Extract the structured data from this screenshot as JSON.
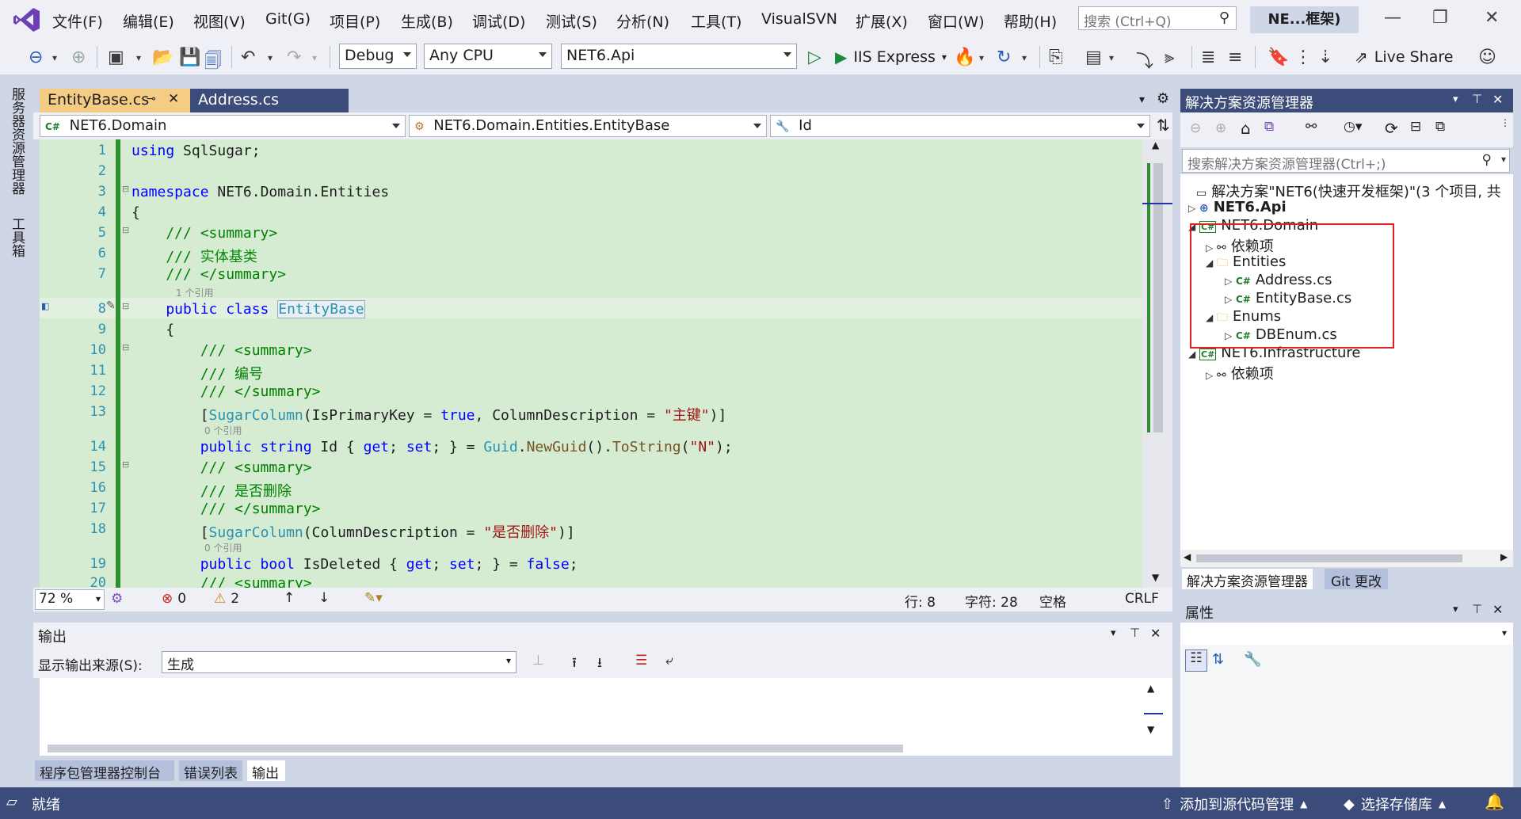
{
  "menu": {
    "items": [
      "文件(F)",
      "编辑(E)",
      "视图(V)",
      "Git(G)",
      "项目(P)",
      "生成(B)",
      "调试(D)",
      "测试(S)",
      "分析(N)",
      "工具(T)",
      "VisualSVN",
      "扩展(X)",
      "窗口(W)",
      "帮助(H)"
    ],
    "search_placeholder": "搜索 (Ctrl+Q)",
    "solution_title": "NE...框架)"
  },
  "toolbar": {
    "config": "Debug",
    "platform": "Any CPU",
    "startup_project": "NET6.Api",
    "run_label": "IIS Express",
    "live_share": "Live Share"
  },
  "siderail": {
    "server_explorer": "服务器资源管理器",
    "toolbox": "工具箱"
  },
  "tabs": {
    "active": "EntityBase.cs",
    "inactive": "Address.cs"
  },
  "navbar": {
    "project": "NET6.Domain",
    "type": "NET6.Domain.Entities.EntityBase",
    "member": "Id"
  },
  "editor": {
    "line_numbers": [
      "1",
      "2",
      "3",
      "4",
      "5",
      "6",
      "7",
      "8",
      "9",
      "10",
      "11",
      "12",
      "13",
      "14",
      "15",
      "16",
      "17",
      "18",
      "19",
      "20"
    ],
    "lens_refs_1": "1 个引用",
    "lens_refs_0a": "0 个引用",
    "lens_refs_0b": "0 个引用",
    "lines": {
      "l1_kw": "using",
      "l1_rest": " SqlSugar;",
      "l3_kw": "namespace",
      "l3_rest": " NET6.Domain.Entities",
      "l4": "{",
      "l5": "    /// <summary>",
      "l6_a": "    /// ",
      "l6_b": "实体基类",
      "l7": "    /// </summary>",
      "l8_kw": "    public class ",
      "l8_cls": "EntityBase",
      "l9": "    {",
      "l10": "        /// <summary>",
      "l11_a": "        /// ",
      "l11_b": "编号",
      "l12": "        /// </summary>",
      "l13_a": "        [",
      "l13_attr": "SugarColumn",
      "l13_b": "(IsPrimaryKey = ",
      "l13_true": "true",
      "l13_c": ", ColumnDescription = ",
      "l13_str": "\"主键\"",
      "l13_d": ")]",
      "l14_kw": "        public string",
      "l14_a": " Id { ",
      "l14_get": "get",
      "l14_b": "; ",
      "l14_set": "set",
      "l14_c": "; } = ",
      "l14_guid": "Guid",
      "l14_d": ".",
      "l14_ng": "NewGuid",
      "l14_e": "().",
      "l14_ts": "ToString",
      "l14_f": "(",
      "l14_str": "\"N\"",
      "l14_g": ");",
      "l15": "        /// <summary>",
      "l16_a": "        /// ",
      "l16_b": "是否删除",
      "l17": "        /// </summary>",
      "l18_a": "        [",
      "l18_attr": "SugarColumn",
      "l18_b": "(ColumnDescription = ",
      "l18_str": "\"是否删除\"",
      "l18_c": ")]",
      "l19_kw": "        public bool",
      "l19_a": " IsDeleted { ",
      "l19_get": "get",
      "l19_b": "; ",
      "l19_set": "set",
      "l19_c": "; } = ",
      "l19_false": "false",
      "l19_d": ";",
      "l20": "        /// <summary>"
    }
  },
  "editor_status": {
    "zoom": "72 %",
    "errors": "0",
    "warnings": "2",
    "line": "行: 8",
    "char": "字符: 28",
    "spaces": "空格",
    "eol": "CRLF"
  },
  "output": {
    "title": "输出",
    "source_label": "显示输出来源(S):",
    "source_value": "生成",
    "tabs": [
      "程序包管理器控制台",
      "错误列表",
      "输出"
    ]
  },
  "solution_explorer": {
    "title": "解决方案资源管理器",
    "search_placeholder": "搜索解决方案资源管理器(Ctrl+;)",
    "tree": {
      "solution": "解决方案\"NET6(快速开发框架)\"(3 个项目, 共",
      "api": "NET6.Api",
      "domain": "NET6.Domain",
      "domain_deps": "依赖项",
      "entities": "Entities",
      "address": "Address.cs",
      "entitybase": "EntityBase.cs",
      "enums": "Enums",
      "dbenum": "DBEnum.cs",
      "infra": "NET6.Infrastructure",
      "infra_deps": "依赖项"
    },
    "tabs": [
      "解决方案资源管理器",
      "Git 更改"
    ]
  },
  "properties": {
    "title": "属性"
  },
  "statusbar": {
    "ready": "就绪",
    "add_source": "添加到源代码管理",
    "select_repo": "选择存储库"
  },
  "colors": {
    "accent": "#3c4c7a",
    "editor_bg": "#d5ecd3",
    "highlight_box": "#e02020"
  }
}
